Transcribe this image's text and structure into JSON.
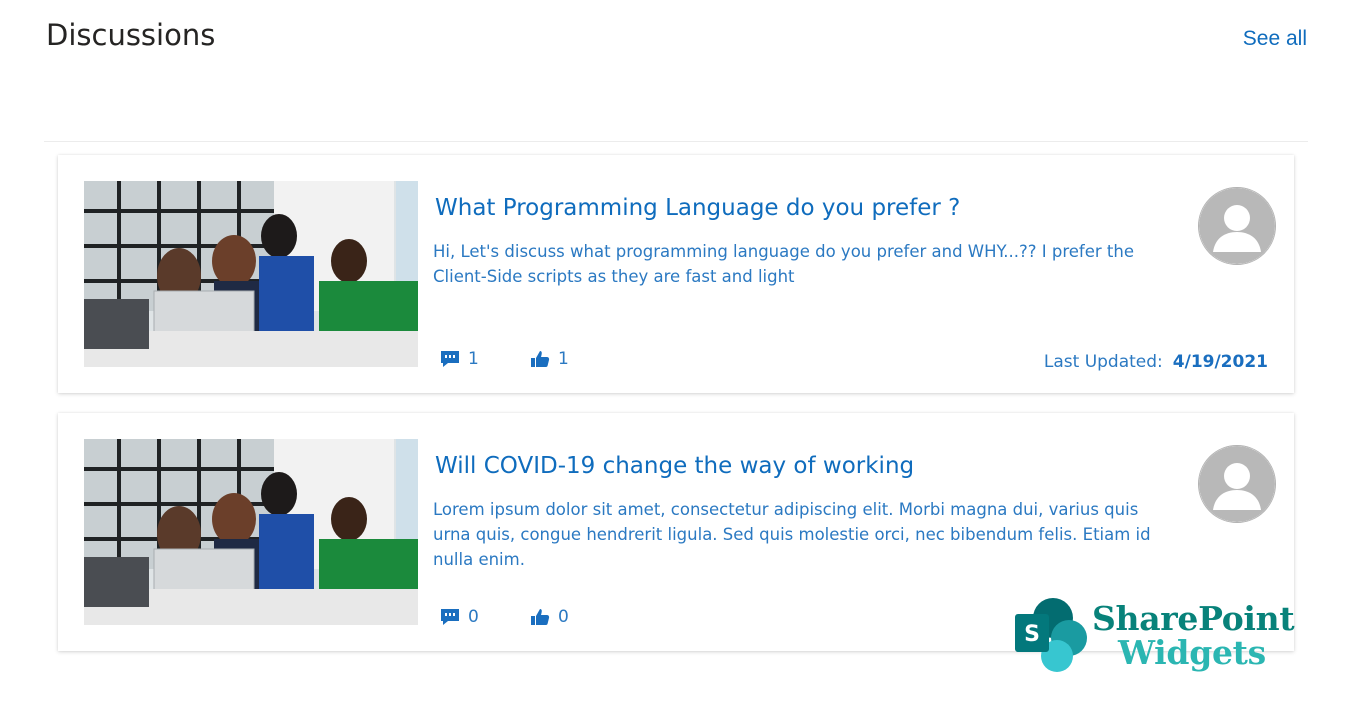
{
  "header": {
    "title": "Discussions",
    "see_all_label": "See all"
  },
  "discussions": [
    {
      "title": "What Programming Language do you prefer ?",
      "description": "Hi, Let's discuss what programming language do you prefer and WHY...?? I prefer the Client-Side scripts as they are fast and light",
      "comments": "1",
      "likes": "1",
      "last_updated_label": "Last Updated:",
      "last_updated_date": "4/19/2021"
    },
    {
      "title": "Will COVID-19 change the way of working",
      "description": "Lorem ipsum dolor sit amet, consectetur adipiscing elit. Morbi magna dui, varius quis urna quis, congue hendrerit ligula. Sed quis molestie orci, nec bibendum felis. Etiam id nulla enim.",
      "comments": "0",
      "likes": "0"
    }
  ],
  "icons": {
    "comment": "comment-icon",
    "like": "thumbs-up-icon",
    "avatar": "user-avatar-icon"
  },
  "colors": {
    "link": "#0f6cbd",
    "text_blue": "#2b79c2",
    "brand_dark": "#08827a",
    "brand_light": "#2bb6b2"
  },
  "watermark": {
    "line1": "SharePoint",
    "line2": "Widgets",
    "logo_letter": "S"
  }
}
